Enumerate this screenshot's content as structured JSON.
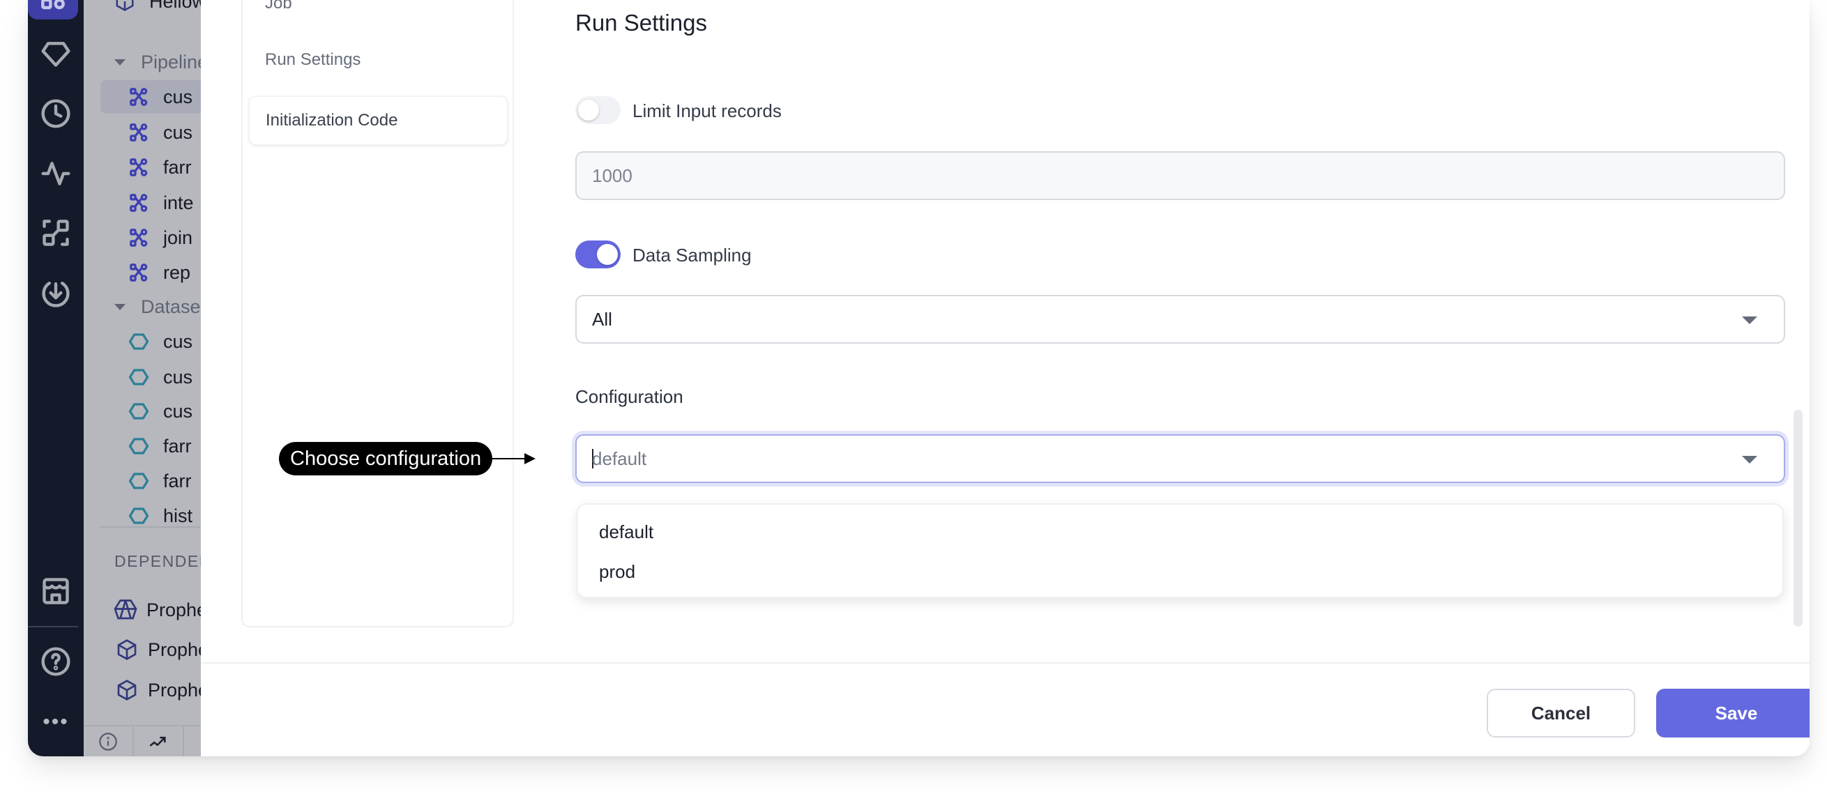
{
  "rail": {
    "items": [
      {
        "icon": "projects-icon",
        "active": true
      },
      {
        "icon": "gem-icon"
      },
      {
        "icon": "clock-icon"
      },
      {
        "icon": "activity-icon"
      },
      {
        "icon": "lineage-icon"
      },
      {
        "icon": "download-icon"
      },
      {
        "icon": "marketplace-icon"
      },
      {
        "icon": "help-icon"
      },
      {
        "icon": "more-icon"
      }
    ],
    "more_label": "•••"
  },
  "tree": {
    "project_label": "Hellow",
    "pipelines_header": "Pipeline",
    "pipelines": [
      "cus",
      "cus",
      "farr",
      "inte",
      "join",
      "rep"
    ],
    "datasets_header": "Dataset",
    "datasets": [
      "cus",
      "cus",
      "cus",
      "farr",
      "farr",
      "hist"
    ],
    "dependencies_label": "DEPENDENC",
    "dependencies": [
      "Prophe",
      "Prophe",
      "Prophe"
    ],
    "bottom_tabs": [
      "info-icon",
      "trend-icon"
    ]
  },
  "dialog": {
    "menu": [
      {
        "label": "Job",
        "active": false
      },
      {
        "label": "Run Settings",
        "active": false
      },
      {
        "label": "Initialization Code",
        "active": true
      }
    ],
    "title": "Run Settings",
    "limit_input": {
      "label": "Limit Input records",
      "enabled": false,
      "value": "1000"
    },
    "data_sampling": {
      "label": "Data Sampling",
      "enabled": true,
      "selected": "All"
    },
    "configuration": {
      "label": "Configuration",
      "value": "default",
      "options": [
        "default",
        "prod"
      ]
    },
    "buttons": {
      "cancel": "Cancel",
      "save": "Save"
    },
    "colors": {
      "accent": "#6469e0",
      "rail_bg": "#141a29",
      "active_rail": "#3d3ea6"
    }
  },
  "annotation": {
    "callout": "Choose configuration"
  }
}
